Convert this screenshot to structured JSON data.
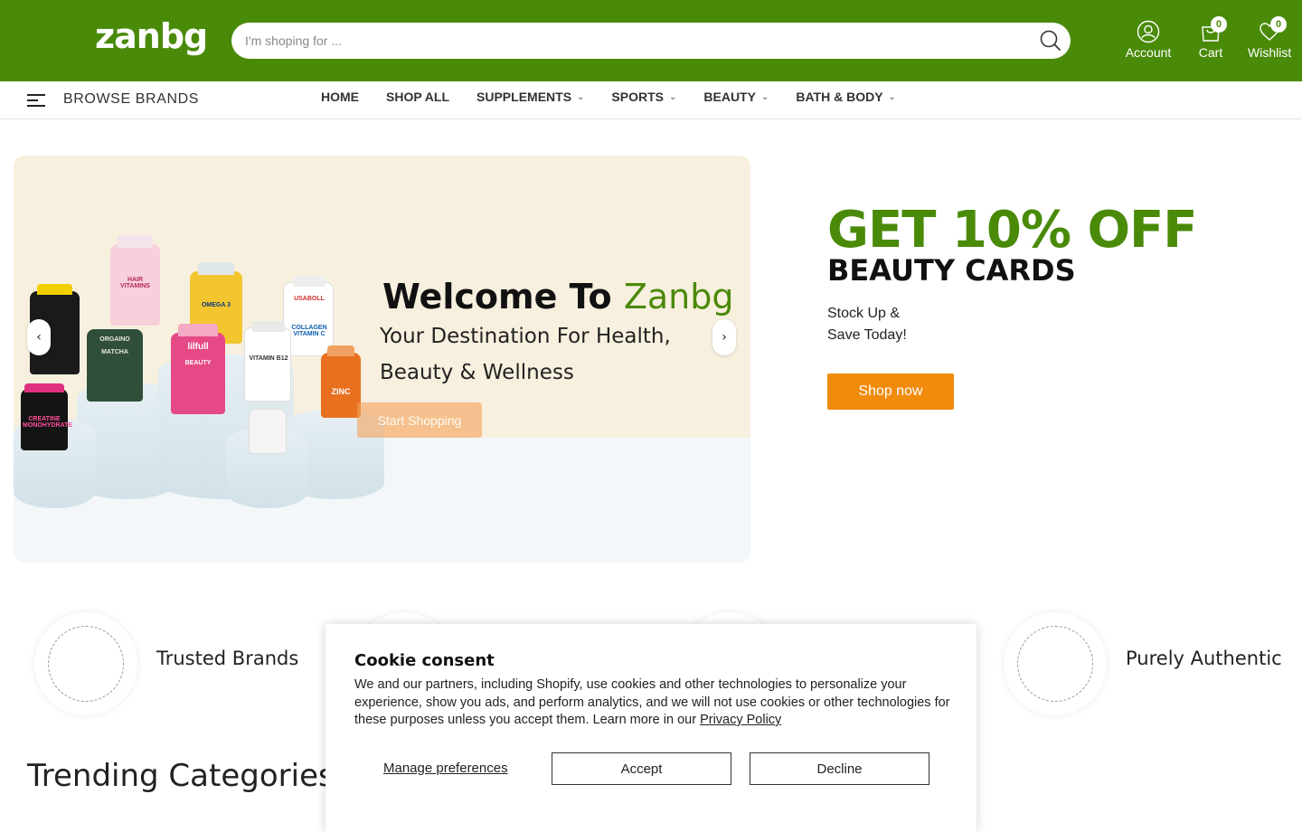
{
  "header": {
    "logo_text": "zanbg",
    "search": {
      "placeholder": "I'm shoping for ..."
    },
    "account_label": "Account",
    "cart_label": "Cart",
    "cart_count": "0",
    "wishlist_label": "Wishlist",
    "wishlist_count": "0",
    "bg_color": "#4a8a09"
  },
  "nav": {
    "browse_label": "BROWSE BRANDS",
    "items": [
      {
        "label": "HOME",
        "has_dropdown": false
      },
      {
        "label": "SHOP ALL",
        "has_dropdown": false
      },
      {
        "label": "SUPPLEMENTS",
        "has_dropdown": true
      },
      {
        "label": "SPORTS",
        "has_dropdown": true
      },
      {
        "label": "BEAUTY",
        "has_dropdown": true
      },
      {
        "label": "BATH & BODY",
        "has_dropdown": true
      }
    ]
  },
  "hero": {
    "welcome": "Welcome To ",
    "brand": "Zanbg",
    "tagline_line1": "Your Destination For Health,",
    "tagline_line2": "Beauty & Wellness",
    "cta": "Start Shopping",
    "product_labels": [
      "HAIR VITAMINS",
      "OMEGA 3",
      "USABOLL",
      "MATCHA",
      "BEAUTY",
      "VITAMIN B12",
      "COLLAGEN VITAMIN C",
      "ZINC",
      "CREATINE MONOHYDRATE",
      "lilfull",
      "ORGAINO"
    ]
  },
  "promo": {
    "title": "GET 10% OFF",
    "subtitle": "BEAUTY CARDS",
    "text_line1": "Stock Up &",
    "text_line2": "Save Today!",
    "cta": "Shop now",
    "accent": "#f08b0b"
  },
  "features": [
    {
      "label": "Trusted Brands"
    },
    {
      "label": "Purely Authentic"
    }
  ],
  "trending_title": "Trending Categories",
  "cookie": {
    "title": "Cookie consent",
    "text": "We and our partners, including Shopify, use cookies and other technologies to personalize your experience, show you ads, and perform analytics, and we will not use cookies or other technologies for these purposes unless you accept them. Learn more in our ",
    "link": "Privacy Policy",
    "manage": "Manage preferences",
    "accept": "Accept",
    "decline": "Decline"
  },
  "icons": [
    "search-icon",
    "user-icon",
    "cart-icon",
    "heart-icon",
    "menu-icon",
    "chevron-down-icon",
    "chevron-left-icon",
    "chevron-right-icon"
  ]
}
